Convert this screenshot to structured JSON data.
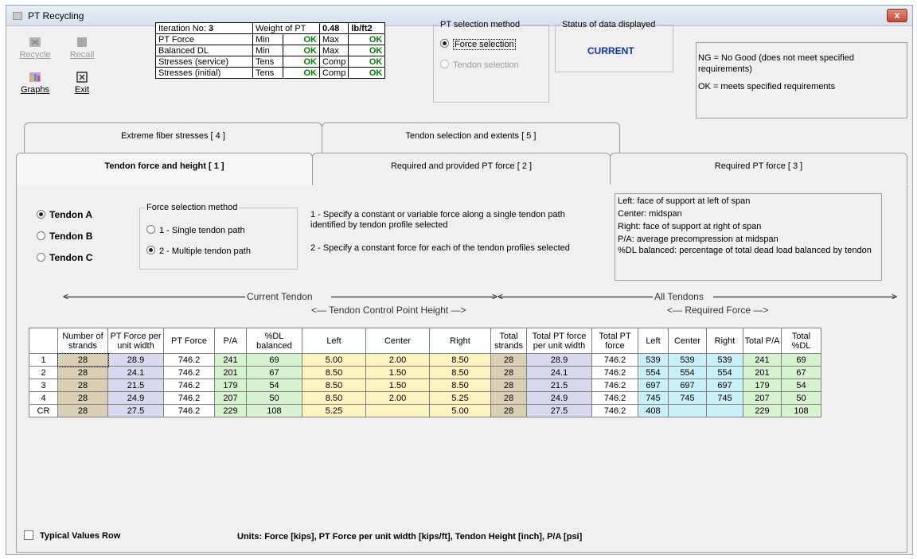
{
  "window": {
    "title": "PT Recycling",
    "close_symbol": "x"
  },
  "toolbar": {
    "recycle": "Recycle",
    "recall": "Recall",
    "graphs": "Graphs",
    "exit": "Exit"
  },
  "iteration": {
    "label": "Iteration No:",
    "number": "3",
    "weight_label": "Weight of PT",
    "weight_value": "0.48",
    "weight_unit": "lb/ft2",
    "rows": [
      {
        "label": "PT Force",
        "a": "Min",
        "a_val": "OK",
        "b": "Max",
        "b_val": "OK"
      },
      {
        "label": "Balanced DL",
        "a": "Min",
        "a_val": "OK",
        "b": "Max",
        "b_val": "OK"
      },
      {
        "label": "Stresses (service)",
        "a": "Tens",
        "a_val": "OK",
        "b": "Comp",
        "b_val": "OK"
      },
      {
        "label": "Stresses (initial)",
        "a": "Tens",
        "a_val": "OK",
        "b": "Comp",
        "b_val": "OK"
      }
    ]
  },
  "pt_selection": {
    "legend": "PT selection method",
    "force": "Force selection",
    "tendon": "Tendon selection"
  },
  "status": {
    "legend": "Status of data displayed",
    "value": "CURRENT"
  },
  "legend_box": {
    "line1": "NG = No Good (does not meet specified requirements)",
    "line2": "OK = meets specified requirements"
  },
  "tabs": {
    "back": [
      "Extreme fiber stresses [ 4 ]",
      "Tendon selection and extents [ 5 ]"
    ],
    "front": [
      "Tendon force and height [ 1 ]",
      "Required and provided PT force [ 2 ]",
      "Required PT force [ 3 ]"
    ]
  },
  "tendons": {
    "a": "Tendon A",
    "b": "Tendon B",
    "c": "Tendon C"
  },
  "force_method": {
    "legend": "Force selection method",
    "opt1": "1 - Single tendon path",
    "opt2": "2 - Multiple tendon path"
  },
  "desc": {
    "d1": "1 - Specify a constant or variable force along a single tendon path identified by tendon profile selected",
    "d2": "2 - Specify a constant force for each of the tendon profiles selected"
  },
  "notes": [
    "Left: face of support at left of span",
    "Center: midspan",
    "Right: face of support at right of span",
    "P/A: average precompression at midspan",
    "%DL balanced: percentage of total dead load balanced by tendon"
  ],
  "headings": {
    "current": "Current Tendon",
    "control": "Tendon Control Point Height",
    "all": "All Tendons",
    "required": "Required Force"
  },
  "grid": {
    "columns": [
      "",
      "Number of strands",
      "PT Force per unit width",
      "PT Force",
      "P/A",
      "%DL balanced",
      "Left",
      "Center",
      "Right",
      "Total strands",
      "Total PT force per unit width",
      "Total PT force",
      "Left",
      "Center",
      "Right",
      "Total P/A",
      "Total %DL"
    ],
    "rows": [
      [
        "1",
        "28",
        "28.9",
        "746.2",
        "241",
        "69",
        "5.00",
        "2.00",
        "8.50",
        "28",
        "28.9",
        "746.2",
        "539",
        "539",
        "539",
        "241",
        "69"
      ],
      [
        "2",
        "28",
        "24.1",
        "746.2",
        "201",
        "67",
        "8.50",
        "1.50",
        "8.50",
        "28",
        "24.1",
        "746.2",
        "554",
        "554",
        "554",
        "201",
        "67"
      ],
      [
        "3",
        "28",
        "21.5",
        "746.2",
        "179",
        "54",
        "8.50",
        "1.50",
        "8.50",
        "28",
        "21.5",
        "746.2",
        "697",
        "697",
        "697",
        "179",
        "54"
      ],
      [
        "4",
        "28",
        "24.9",
        "746.2",
        "207",
        "50",
        "8.50",
        "2.00",
        "5.25",
        "28",
        "24.9",
        "746.2",
        "745",
        "745",
        "745",
        "207",
        "50"
      ],
      [
        "CR",
        "28",
        "27.5",
        "746.2",
        "229",
        "108",
        "5.25",
        "",
        "5.00",
        "28",
        "27.5",
        "746.2",
        "408",
        "",
        "",
        "229",
        "108"
      ]
    ]
  },
  "footer": {
    "typical": "Typical Values Row",
    "units": "Units: Force [kips], PT Force per unit width [kips/ft], Tendon Height [inch], P/A [psi]"
  }
}
